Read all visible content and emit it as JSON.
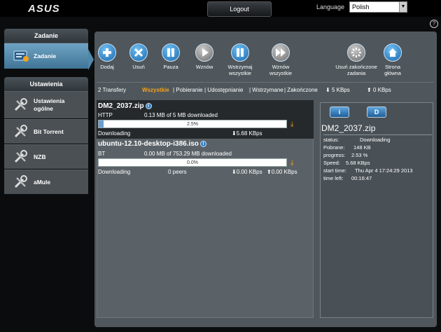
{
  "header": {
    "logo": "ASUS",
    "logout_label": "Logout",
    "language_label": "Language",
    "language_value": "Polish",
    "help_icon": "?"
  },
  "sidebar": {
    "section1_title": "Zadanie",
    "section1_items": [
      {
        "label": "Zadanie",
        "icon": "task-icon",
        "active": true
      }
    ],
    "section2_title": "Ustawienia",
    "section2_items": [
      {
        "label": "Ustawienia ogólne",
        "line1": "Ustawienia",
        "line2": "ogólne",
        "icon": "tools-icon"
      },
      {
        "label": "Bit Torrent",
        "icon": "tools-icon"
      },
      {
        "label": "NZB",
        "icon": "tools-icon"
      },
      {
        "label": "aMule",
        "icon": "tools-icon"
      }
    ]
  },
  "toolbar": {
    "add": "Dodaj",
    "delete": "Usuń",
    "pause": "Pauza",
    "resume": "Wznów",
    "pause_all_1": "Wstrzymaj",
    "pause_all_2": "wszystkie",
    "resume_all_1": "Wznów",
    "resume_all_2": "wszystkie",
    "remove_done_1": "Usuń zakończone",
    "remove_done_2": "zadania",
    "home_1": "Strona",
    "home_2": "główna"
  },
  "filters": {
    "count": "2 Transfery",
    "all": "Wszystkie",
    "downloading": "| Pobieranie",
    "seeding": "| Udostępnianie",
    "paused": "| Wstrzymane",
    "finished": "| Zakończone",
    "down_total": "5 KBps",
    "up_total": "0 KBps"
  },
  "tasks": [
    {
      "name": "DM2_2037.zip",
      "protocol": "HTTP",
      "detail": "0.13 MB of 5 MB downloaded",
      "progress": 2.5,
      "progress_label": "2.5%",
      "status": "Downloading",
      "peers": "",
      "down": "5.68 KBps",
      "up": ""
    },
    {
      "name": "ubuntu-12.10-desktop-i386.iso",
      "protocol": "BT",
      "detail": "0.00 MB of 753.29 MB downloaded",
      "progress": 0.0,
      "progress_label": "0.0%",
      "status": "Downloading",
      "peers": "0 peers",
      "down": "0.00 KBps",
      "up": "0.00 KBps"
    }
  ],
  "detail": {
    "btn_info": "i",
    "btn_d": "D",
    "title": "DM2_2037.zip",
    "status_label": "status:",
    "status_value": "Downloading",
    "downloaded_label": "Pobrane:",
    "downloaded_value": "148 KB",
    "progress_label": "progress:",
    "progress_value": "2.53 %",
    "speed_label": "Speed:",
    "speed_value": "5.68 KBps",
    "start_label": "start time:",
    "start_value": "Thu Apr 4 17:24:29 2013",
    "left_label": "time left:",
    "left_value": "00:16:47"
  },
  "colors": {
    "accent": "#f7a21b",
    "active_nav": "#4f88aa",
    "panel": "#4f575c"
  }
}
